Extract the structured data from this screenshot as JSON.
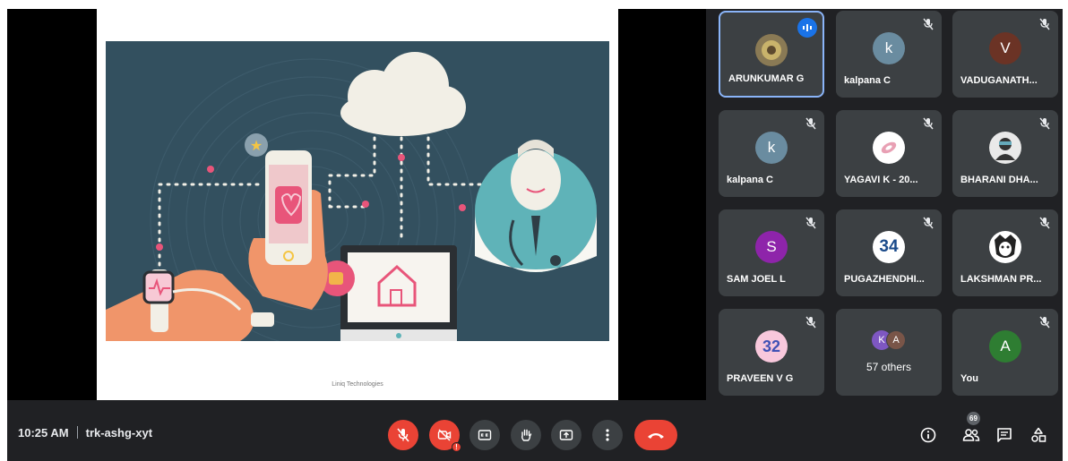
{
  "presentation": {
    "footer_text": "Liniq Technologies"
  },
  "participants": [
    {
      "name": "ARUNKUMAR G",
      "initial": "",
      "avatar_color": "#5d4a2e",
      "speaking": true
    },
    {
      "name": "kalpana C",
      "initial": "k",
      "avatar_color": "#6a8ca0",
      "speaking": false
    },
    {
      "name": "VADUGANATH...",
      "initial": "V",
      "avatar_color": "#6b3325",
      "speaking": false
    },
    {
      "name": "kalpana C",
      "initial": "k",
      "avatar_color": "#6a8ca0",
      "speaking": false
    },
    {
      "name": "YAGAVI K - 20...",
      "initial": "",
      "avatar_color": "#ffffff",
      "speaking": false
    },
    {
      "name": "BHARANI DHA...",
      "initial": "",
      "avatar_color": "#2a2a2a",
      "speaking": false
    },
    {
      "name": "SAM JOEL L",
      "initial": "S",
      "avatar_color": "#8e24aa",
      "speaking": false
    },
    {
      "name": "PUGAZHENDHI...",
      "initial": "34",
      "avatar_color": "#ffffff",
      "speaking": false
    },
    {
      "name": "LAKSHMAN PR...",
      "initial": "",
      "avatar_color": "#ffffff",
      "speaking": false
    },
    {
      "name": "PRAVEEN V G",
      "initial": "32",
      "avatar_color": "#f8c8dc",
      "speaking": false
    }
  ],
  "others_tile": {
    "label": "57 others",
    "initials": [
      "K",
      "A"
    ],
    "colors": [
      "#7e57c2",
      "#795548"
    ]
  },
  "self_tile": {
    "name": "You",
    "initial": "A",
    "avatar_color": "#2e7d32"
  },
  "meeting": {
    "time": "10:25 AM",
    "code": "trk-ashg-xyt"
  },
  "people_count": "69",
  "colors": {
    "danger": "#ea4335",
    "accent": "#1a73e8",
    "tile_bg": "#3c4043",
    "app_bg": "#202124"
  },
  "icons": [
    "mic-off-icon",
    "camera-off-icon",
    "captions-icon",
    "raise-hand-icon",
    "present-icon",
    "more-vert-icon",
    "end-call-icon",
    "info-icon",
    "people-icon",
    "chat-icon",
    "activities-icon"
  ]
}
